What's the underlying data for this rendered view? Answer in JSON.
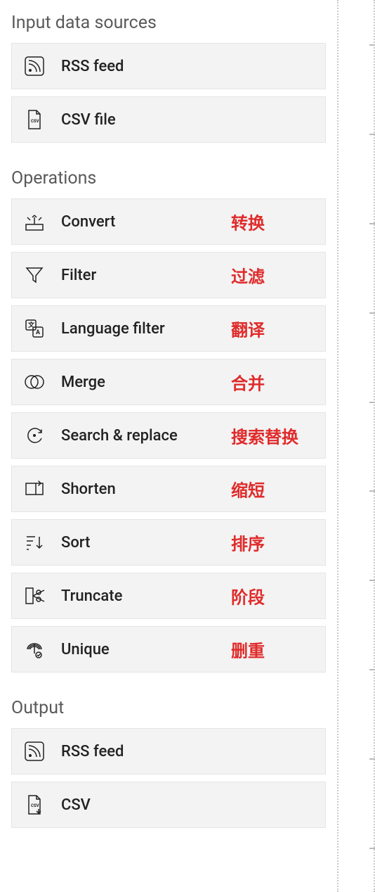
{
  "sections": {
    "input": {
      "title": "Input data sources",
      "items": [
        {
          "label": "RSS feed",
          "icon": "rss-icon"
        },
        {
          "label": "CSV file",
          "icon": "csv-file-icon"
        }
      ]
    },
    "operations": {
      "title": "Operations",
      "items": [
        {
          "label": "Convert",
          "icon": "convert-icon",
          "annotation": "转换"
        },
        {
          "label": "Filter",
          "icon": "filter-icon",
          "annotation": "过滤"
        },
        {
          "label": "Language filter",
          "icon": "language-filter-icon",
          "annotation": "翻译"
        },
        {
          "label": "Merge",
          "icon": "merge-icon",
          "annotation": "合并"
        },
        {
          "label": "Search & replace",
          "icon": "search-replace-icon",
          "annotation": "搜索替换"
        },
        {
          "label": "Shorten",
          "icon": "shorten-icon",
          "annotation": "缩短"
        },
        {
          "label": "Sort",
          "icon": "sort-icon",
          "annotation": "排序"
        },
        {
          "label": "Truncate",
          "icon": "truncate-icon",
          "annotation": "阶段"
        },
        {
          "label": "Unique",
          "icon": "unique-icon",
          "annotation": "删重"
        }
      ]
    },
    "output": {
      "title": "Output",
      "items": [
        {
          "label": "RSS feed",
          "icon": "rss-icon"
        },
        {
          "label": "CSV",
          "icon": "csv-download-icon"
        }
      ]
    }
  },
  "colors": {
    "annotation": "#e02b2b",
    "item_bg": "#f3f3f3",
    "text": "#222222",
    "heading": "#5a5a5a"
  }
}
